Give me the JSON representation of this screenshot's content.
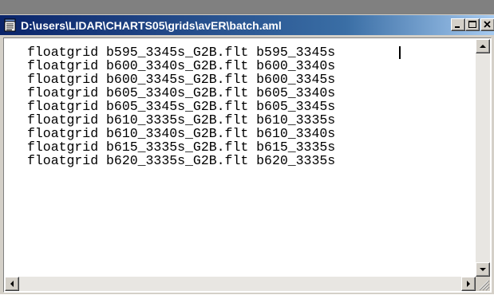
{
  "window": {
    "title": "D:\\users\\LIDAR\\CHARTS05\\grids\\avER\\batch.aml",
    "controls": {
      "minimize_icon": "minimize-icon",
      "maximize_icon": "maximize-icon",
      "close_icon": "close-icon"
    }
  },
  "editor": {
    "lines": [
      "floatgrid b595_3345s_G2B.flt b595_3345s",
      "floatgrid b600_3340s_G2B.flt b600_3340s",
      "floatgrid b600_3345s_G2B.flt b600_3345s",
      "floatgrid b605_3340s_G2B.flt b605_3340s",
      "floatgrid b605_3345s_G2B.flt b605_3345s",
      "floatgrid b610_3335s_G2B.flt b610_3335s",
      "floatgrid b610_3340s_G2B.flt b610_3340s",
      "floatgrid b615_3335s_G2B.flt b615_3335s",
      "floatgrid b620_3335s_G2B.flt b620_3335s"
    ]
  },
  "colors": {
    "titlebar_start": "#0a246a",
    "titlebar_end": "#a6caf0",
    "face": "#d4d0c8"
  }
}
